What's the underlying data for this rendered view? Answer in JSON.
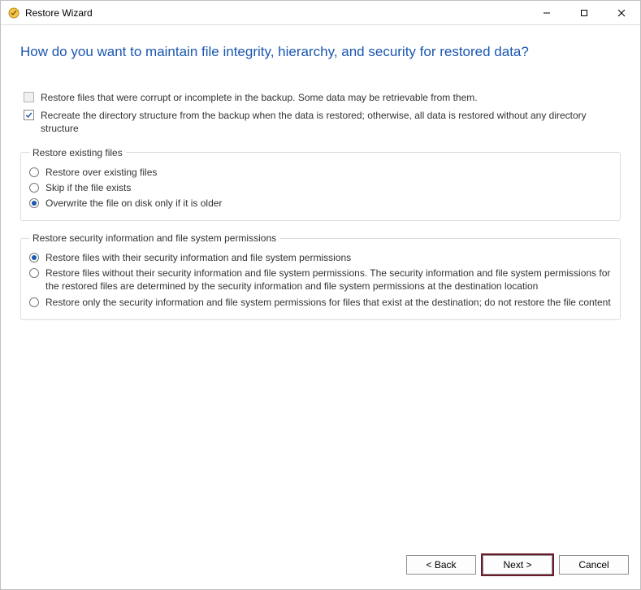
{
  "window": {
    "title": "Restore Wizard"
  },
  "heading": "How do you want to maintain file integrity, hierarchy, and security for restored data?",
  "options": {
    "restore_corrupt": {
      "label": "Restore files that were corrupt or incomplete in the backup. Some data may be retrievable from them.",
      "checked": false,
      "enabled": false
    },
    "recreate_dir": {
      "label": "Recreate the directory structure from the backup when the data is restored; otherwise, all data is restored without any directory structure",
      "checked": true,
      "enabled": true
    }
  },
  "groups": {
    "existing": {
      "legend": "Restore existing files",
      "selected_index": 2,
      "items": [
        "Restore over existing files",
        "Skip if the file exists",
        "Overwrite the file on disk only if it is older"
      ]
    },
    "security": {
      "legend": "Restore security information and file system permissions",
      "selected_index": 0,
      "items": [
        "Restore files with their security information and file system permissions",
        "Restore files without their security information and file system permissions. The security information and file system permissions for the restored files are determined by the security information and file system permissions at the destination location",
        "Restore only the security information and file system permissions for files that exist at the destination; do not restore the file content"
      ]
    }
  },
  "footer": {
    "back": "< Back",
    "next": "Next >",
    "cancel": "Cancel"
  }
}
